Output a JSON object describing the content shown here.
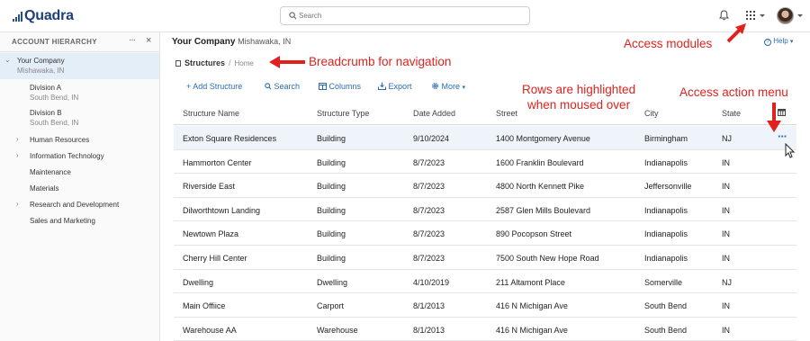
{
  "app": {
    "logo_text": "Quadra"
  },
  "search": {
    "placeholder": "Search"
  },
  "sidebar": {
    "title": "ACCOUNT HIERARCHY",
    "more": "···",
    "close": "×",
    "items": [
      {
        "label": "Your Company",
        "sub": "Mishawaka, IN"
      },
      {
        "label": "Division A",
        "sub": "South Bend, IN"
      },
      {
        "label": "Division B",
        "sub": "South Bend, IN"
      },
      {
        "label": "Human Resources"
      },
      {
        "label": "Information Technology"
      },
      {
        "label": "Maintenance"
      },
      {
        "label": "Materials"
      },
      {
        "label": "Research and Development"
      },
      {
        "label": "Sales and Marketing"
      }
    ]
  },
  "header": {
    "company": "Your Company",
    "location": "Mishawaka, IN",
    "help": "Help"
  },
  "breadcrumb": {
    "current": "Structures",
    "separator": "/",
    "parent": "Home"
  },
  "toolbar": {
    "add": "+ Add Structure",
    "search": "Search",
    "columns": "Columns",
    "export": "Export",
    "more": "More"
  },
  "table": {
    "columns": [
      "Structure Name",
      "Structure Type",
      "Date Added",
      "Street",
      "City",
      "State"
    ],
    "rows": [
      [
        "Exton Square Residences",
        "Building",
        "9/10/2024",
        "1400 Montgomery Avenue",
        "Birmingham",
        "NJ"
      ],
      [
        "Hammorton Center",
        "Building",
        "8/7/2023",
        "1600 Franklin Boulevard",
        "Indianapolis",
        "IN"
      ],
      [
        "Riverside East",
        "Building",
        "8/7/2023",
        "4800 North Kennett Pike",
        "Jeffersonville",
        "IN"
      ],
      [
        "Dilworthtown Landing",
        "Building",
        "8/7/2023",
        "2587 Glen Mills Boulevard",
        "Indianapolis",
        "IN"
      ],
      [
        "Newtown Plaza",
        "Building",
        "8/7/2023",
        "890 Pocopson Street",
        "Indianapolis",
        "IN"
      ],
      [
        "Cherry Hill Center",
        "Building",
        "8/7/2023",
        "7500 South New Hope Road",
        "Indianapolis",
        "IN"
      ],
      [
        "Dwelling",
        "Dwelling",
        "4/10/2019",
        "211 Altamont Place",
        "Somerville",
        "NJ"
      ],
      [
        "Main Offiice",
        "Carport",
        "8/1/2013",
        "416 N Michigan Ave",
        "South Bend",
        "IN"
      ],
      [
        "Warehouse AA",
        "Warehouse",
        "8/1/2013",
        "416 N Michigan Ave",
        "South Bend",
        "IN"
      ]
    ],
    "row_menu": "···"
  },
  "annotations": {
    "modules": "Access modules",
    "breadcrumb": "Breadcrumb for navigation",
    "rows": [
      "Rows are highlighted",
      "when moused over"
    ],
    "action": "Access action menu",
    "color": "#e0211d"
  }
}
